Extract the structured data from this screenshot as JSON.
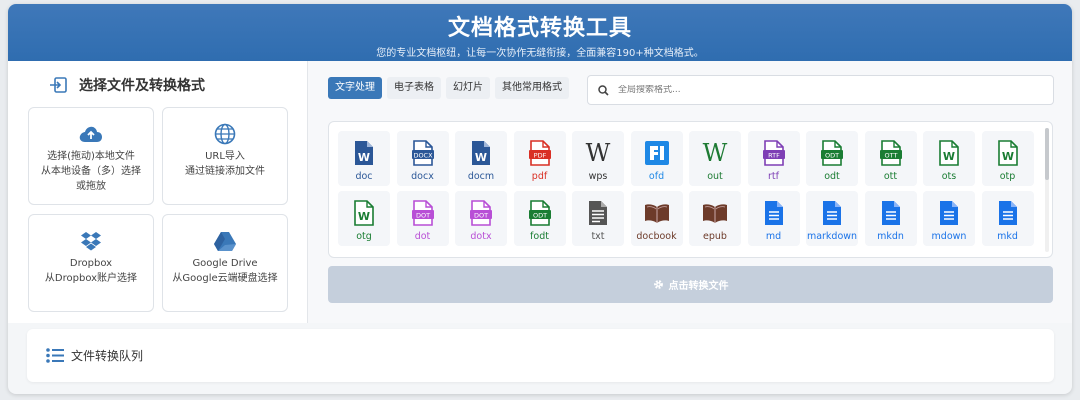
{
  "header": {
    "title": "文档格式转换工具",
    "subtitle": "您的专业文档枢纽，让每一次协作无缝衔接，全面兼容190+种文档格式。"
  },
  "left": {
    "title": "选择文件及转换格式",
    "sources": [
      {
        "icon": "cloud-upload-icon",
        "line1": "选择(拖动)本地文件",
        "line2": "从本地设备（多）选择",
        "line3": "或拖放"
      },
      {
        "icon": "globe-icon",
        "line1": "URL导入",
        "line2": "通过链接添加文件",
        "line3": ""
      },
      {
        "icon": "dropbox-icon",
        "line1": "Dropbox",
        "line2": "从Dropbox账户选择",
        "line3": ""
      },
      {
        "icon": "google-drive-icon",
        "line1": "Google Drive",
        "line2": "从Google云端硬盘选择",
        "line3": ""
      }
    ]
  },
  "tabs": [
    "文字处理",
    "电子表格",
    "幻灯片",
    "其他常用格式"
  ],
  "search": {
    "placeholder": "全局搜索格式..."
  },
  "formats": [
    {
      "label": "doc",
      "icon": "word-file-icon",
      "color": "#2b5797"
    },
    {
      "label": "docx",
      "icon": "docx-file-icon",
      "color": "#2b5797"
    },
    {
      "label": "docm",
      "icon": "word-file-icon",
      "color": "#2b5797"
    },
    {
      "label": "pdf",
      "icon": "pdf-file-icon",
      "color": "#d93025"
    },
    {
      "label": "wps",
      "icon": "wikipedia-w-icon",
      "color": "#333333"
    },
    {
      "label": "ofd",
      "icon": "ofd-icon",
      "color": "#1e88e5"
    },
    {
      "label": "out",
      "icon": "serif-w-icon",
      "color": "#1e7b34"
    },
    {
      "label": "rtf",
      "icon": "rtf-file-icon",
      "color": "#7e3fb5"
    },
    {
      "label": "odt",
      "icon": "odt-file-icon",
      "color": "#1a7d33"
    },
    {
      "label": "ott",
      "icon": "ott-file-icon",
      "color": "#1a7d33"
    },
    {
      "label": "ots",
      "icon": "w-outline-file-icon",
      "color": "#1a7d33"
    },
    {
      "label": "otp",
      "icon": "w-outline-file-icon",
      "color": "#1a7d33"
    },
    {
      "label": "otg",
      "icon": "w-outline-file-icon",
      "color": "#1a7d33"
    },
    {
      "label": "dot",
      "icon": "dot-file-icon",
      "color": "#b84fd6"
    },
    {
      "label": "dotx",
      "icon": "dot-file-icon",
      "color": "#b84fd6"
    },
    {
      "label": "fodt",
      "icon": "odt-file-icon",
      "color": "#1a7d33"
    },
    {
      "label": "txt",
      "icon": "text-file-icon",
      "color": "#555555"
    },
    {
      "label": "docbook",
      "icon": "book-icon",
      "color": "#6d3b2a"
    },
    {
      "label": "epub",
      "icon": "book-icon",
      "color": "#6d3b2a"
    },
    {
      "label": "md",
      "icon": "doc-lines-icon",
      "color": "#1a73e8"
    },
    {
      "label": "markdown",
      "icon": "doc-lines-icon",
      "color": "#1a73e8"
    },
    {
      "label": "mkdn",
      "icon": "doc-lines-icon",
      "color": "#1a73e8"
    },
    {
      "label": "mdown",
      "icon": "doc-lines-icon",
      "color": "#1a73e8"
    },
    {
      "label": "mkd",
      "icon": "doc-lines-icon",
      "color": "#1a73e8"
    }
  ],
  "convert": {
    "label": "点击转换文件"
  },
  "queue": {
    "title": "文件转换队列"
  }
}
